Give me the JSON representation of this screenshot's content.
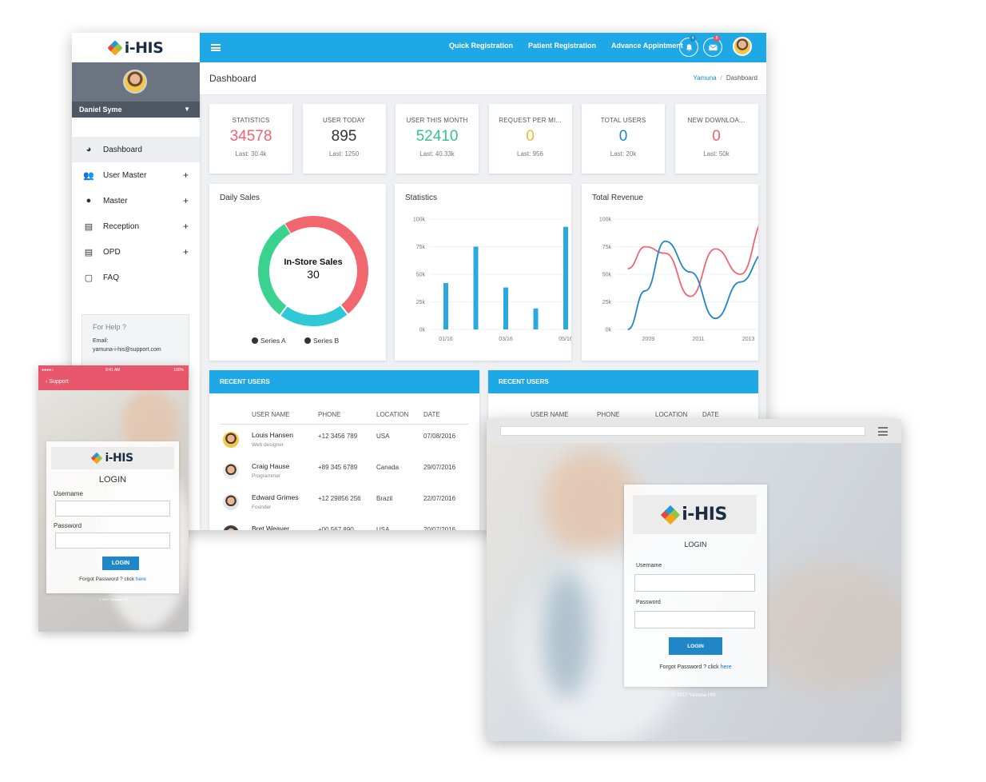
{
  "brand": {
    "name": "i-HIS",
    "mark_colors": [
      "#e8463a",
      "#1f9ad6",
      "#8dc63f",
      "#f4a41c"
    ]
  },
  "sidebar": {
    "user_name": "Daniel Syme",
    "items": [
      {
        "label": "Dashboard",
        "icon": "dashboard-icon",
        "active": true,
        "expandable": false
      },
      {
        "label": "User Master",
        "icon": "users-icon",
        "expandable": true
      },
      {
        "label": "Master",
        "icon": "user-circle-icon",
        "expandable": true
      },
      {
        "label": "Reception",
        "icon": "id-card-icon",
        "expandable": true
      },
      {
        "label": "OPD",
        "icon": "id-card-icon",
        "expandable": true
      },
      {
        "label": "FAQ",
        "icon": "help-chat-icon",
        "expandable": false
      }
    ],
    "help": {
      "title": "For Help ?",
      "email_label": "Email:",
      "email": "yamuna-i-his@support.com"
    },
    "expand_symbol": "+"
  },
  "topbar": {
    "links": [
      "Quick Registration",
      "Patient Registration",
      "Advance Appintment"
    ],
    "notifications": {
      "icon": "bell-icon",
      "count": "4",
      "color": "#1f86c8"
    },
    "messages": {
      "icon": "mail-icon",
      "count": "8",
      "color": "#e8566b"
    }
  },
  "page": {
    "title": "Dashboard",
    "breadcrumb": [
      "Yamuna",
      "Dashboard"
    ],
    "breadcrumb_sep": "/"
  },
  "stats": [
    {
      "label": "STATISTICS",
      "value": "34578",
      "last": "Last: 30.4k",
      "color": "#f2616f"
    },
    {
      "label": "USER TODAY",
      "value": "895",
      "last": "Last: 1250",
      "color": "#333333"
    },
    {
      "label": "USER THIS MONTH",
      "value": "52410",
      "last": "Last: 40.33k",
      "color": "#37c48c"
    },
    {
      "label": "REQUEST PER MI...",
      "value": "0",
      "last": "Last: 956",
      "color": "#f5b82e"
    },
    {
      "label": "TOTAL USERS",
      "value": "0",
      "last": "Last: 20k",
      "color": "#1f86c8"
    },
    {
      "label": "NEW DOWNLOA...",
      "value": "0",
      "last": "Last: 50k",
      "color": "#f2616f"
    }
  ],
  "chart_data": [
    {
      "type": "pie",
      "title": "Daily Sales",
      "center_label": "In-Store Sales",
      "center_value": "30",
      "slices": [
        {
          "value": 48,
          "color": "#f2666f"
        },
        {
          "value": 21,
          "color": "#2ec8d6"
        },
        {
          "value": 31,
          "color": "#39d38f"
        }
      ],
      "legend": [
        {
          "name": "Series A",
          "color": "#333333"
        },
        {
          "name": "Series B",
          "color": "#333333"
        }
      ]
    },
    {
      "type": "bar",
      "title": "Statistics",
      "x_ticks": [
        "01/16",
        "03/16",
        "05/16"
      ],
      "y_ticks": [
        "0k",
        "25k",
        "50k",
        "75k",
        "100k"
      ],
      "ylim": [
        0,
        100
      ],
      "values": [
        42,
        75,
        38,
        19,
        93
      ],
      "color": "#29a9df"
    },
    {
      "type": "line",
      "title": "Total Revenue",
      "x_ticks": [
        "2009",
        "2011",
        "2013",
        "20"
      ],
      "y_ticks": [
        "0k",
        "25k",
        "50k",
        "75k",
        "100k"
      ],
      "xlim": [
        2008,
        2014
      ],
      "ylim": [
        0,
        100
      ],
      "series": [
        {
          "color": "#f2666f",
          "x": [
            2008.5,
            2009.2,
            2010.0,
            2011.0,
            2012.0,
            2013.0,
            2014.0
          ],
          "y": [
            55,
            75,
            69,
            30,
            73,
            50,
            100
          ]
        },
        {
          "color": "#1f86c8",
          "x": [
            2008.5,
            2009.2,
            2010.0,
            2011.0,
            2012.0,
            2013.0,
            2014.0
          ],
          "y": [
            0,
            35,
            80,
            52,
            10,
            43,
            70
          ]
        }
      ]
    }
  ],
  "recent_users": {
    "title": "RECENT USERS",
    "columns": [
      "USER NAME",
      "PHONE",
      "LOCATION",
      "DATE"
    ],
    "rows": [
      {
        "name": "Louis Hansen",
        "role": "Web designer",
        "phone": "+12 3456 789",
        "location": "USA",
        "date": "07/08/2016",
        "avatar_color": "#f2c84b"
      },
      {
        "name": "Craig Hause",
        "role": "Programmer",
        "phone": "+89 345 6789",
        "location": "Canada",
        "date": "29/07/2016",
        "avatar_color": "#e9ecef"
      },
      {
        "name": "Edward Grimes",
        "role": "Founder",
        "phone": "+12 29856 256",
        "location": "Brazil",
        "date": "22/07/2016",
        "avatar_color": "#dfe6ee"
      },
      {
        "name": "Bret Weaver",
        "role": "",
        "phone": "+00 567 890",
        "location": "USA",
        "date": "20/07/2016",
        "avatar_color": "#3c4450"
      }
    ]
  },
  "mobile_login": {
    "status_time": "9:41 AM",
    "battery": "100%",
    "back_label": "Support",
    "title": "LOGIN",
    "username_label": "Username",
    "password_label": "Password",
    "button": "LOGIN",
    "forgot_text": "Forgot Password ? click",
    "forgot_link": "here",
    "copyright": "© 2017 Yamuna HIS",
    "accent": "#e8566b"
  },
  "desktop_login": {
    "title": "LOGIN",
    "username_label": "Username",
    "password_label": "Password",
    "button": "LOGIN",
    "forgot_text": "Forgot Password ? click",
    "forgot_link": "here",
    "copyright": "© 2017 Yamuna HIS"
  }
}
